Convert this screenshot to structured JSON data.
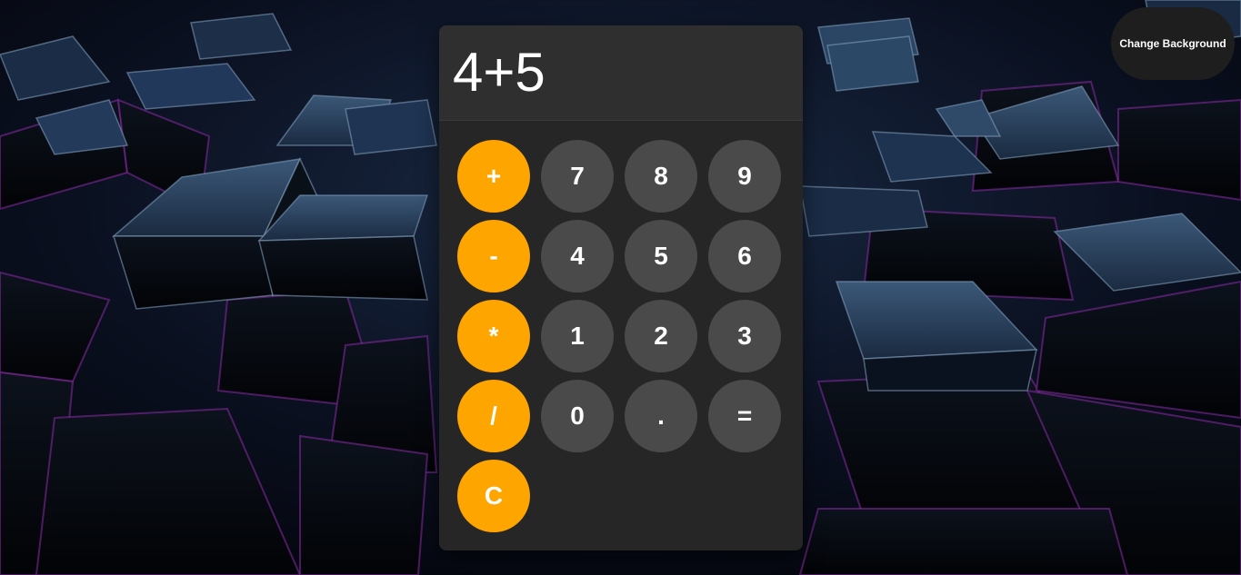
{
  "calculator": {
    "display": "4+5",
    "buttons": {
      "plus": "+",
      "minus": "-",
      "multiply": "*",
      "divide": "/",
      "clear": "C",
      "seven": "7",
      "eight": "8",
      "nine": "9",
      "four": "4",
      "five": "5",
      "six": "6",
      "one": "1",
      "two": "2",
      "three": "3",
      "zero": "0",
      "decimal": ".",
      "equals": "="
    }
  },
  "change_background_label": "Change Background",
  "colors": {
    "operator": "#ffa500",
    "number": "#4a4a4a",
    "calculator_body": "#262626",
    "display": "#2f2f2f",
    "background_glow": "#8a2ba8"
  }
}
